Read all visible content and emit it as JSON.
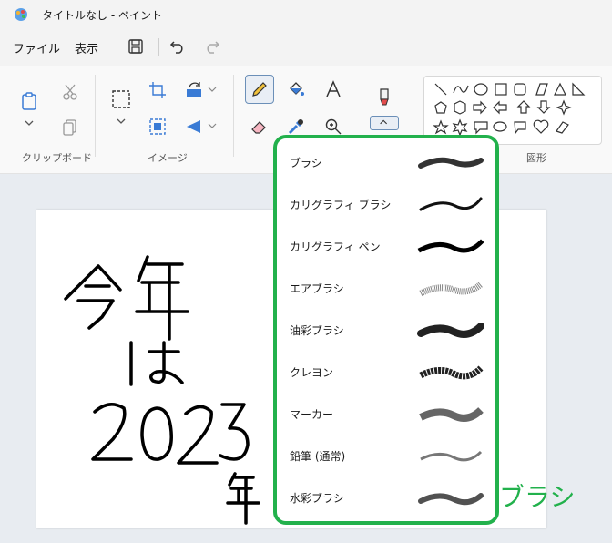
{
  "window": {
    "title": "タイトルなし - ペイント"
  },
  "menu": {
    "file": "ファイル",
    "view": "表示"
  },
  "ribbon": {
    "clipboard_label": "クリップボード",
    "image_label": "イメージ",
    "shapes_label": "図形"
  },
  "brushes": [
    {
      "label": "ブラシ",
      "icon": "brush-stroke"
    },
    {
      "label": "カリグラフィ ブラシ",
      "icon": "calligraphy-brush-stroke"
    },
    {
      "label": "カリグラフィ ペン",
      "icon": "calligraphy-pen-stroke"
    },
    {
      "label": "エアブラシ",
      "icon": "airbrush-stroke"
    },
    {
      "label": "油彩ブラシ",
      "icon": "oil-brush-stroke"
    },
    {
      "label": "クレヨン",
      "icon": "crayon-stroke"
    },
    {
      "label": "マーカー",
      "icon": "marker-stroke"
    },
    {
      "label": "鉛筆 (通常)",
      "icon": "pencil-stroke"
    },
    {
      "label": "水彩ブラシ",
      "icon": "watercolor-stroke"
    }
  ],
  "annotation": "ブラシ",
  "colors": {
    "highlight": "#22b14c",
    "accent": "#6b8fb8"
  }
}
